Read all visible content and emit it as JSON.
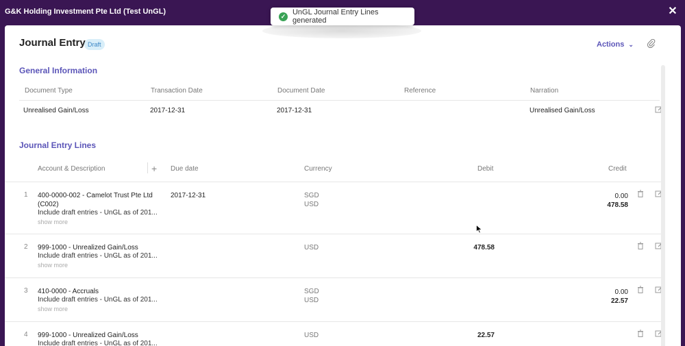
{
  "window": {
    "title": "G&K Holding Investment Pte Ltd (Test UnGL)",
    "close_symbol": "✕"
  },
  "toast": {
    "message": "UnGL Journal Entry Lines generated",
    "icon": "check-circle-icon",
    "color": "#3aa356"
  },
  "page": {
    "title": "Journal Entry",
    "status": "Draft",
    "actions_label": "Actions",
    "attach_icon": "paperclip-icon"
  },
  "general_information": {
    "section_title": "General Information",
    "headers": [
      "Document Type",
      "Transaction Date",
      "Document Date",
      "Reference",
      "Narration"
    ],
    "values": {
      "document_type": "Unrealised Gain/Loss",
      "transaction_date": "2017-12-31",
      "document_date": "2017-12-31",
      "reference": "",
      "narration": "Unrealised Gain/Loss"
    }
  },
  "journal_entry_lines": {
    "section_title": "Journal Entry Lines",
    "headers": {
      "account": "Account & Description",
      "due_date": "Due date",
      "currency": "Currency",
      "debit": "Debit",
      "credit": "Credit"
    },
    "show_more_label": "show more",
    "rows": [
      {
        "num": "1",
        "account": "400-0000-002 - Camelot Trust Pte Ltd (C002)",
        "description": "Include draft entries - UnGL as of 201...",
        "due_date": "2017-12-31",
        "currency": [
          "SGD",
          "USD"
        ],
        "debit": "",
        "credit": [
          "0.00",
          "478.58"
        ]
      },
      {
        "num": "2",
        "account": "999-1000 - Unrealized Gain/Loss",
        "description": "Include draft entries - UnGL as of 201...",
        "due_date": "",
        "currency": [
          "USD"
        ],
        "debit": "478.58",
        "credit": []
      },
      {
        "num": "3",
        "account": "410-0000 - Accruals",
        "description": "Include draft entries - UnGL as of 201...",
        "due_date": "",
        "currency": [
          "SGD",
          "USD"
        ],
        "debit": "",
        "credit": [
          "0.00",
          "22.57"
        ]
      },
      {
        "num": "4",
        "account": "999-1000 - Unrealized Gain/Loss",
        "description": "Include draft entries - UnGL as of 201...",
        "due_date": "",
        "currency": [
          "USD"
        ],
        "debit": "22.57",
        "credit": []
      }
    ]
  },
  "colors": {
    "brand": "#3a1653",
    "accent": "#5b55b8",
    "badge_bg": "#d8eef9",
    "badge_text": "#3b87c6"
  }
}
